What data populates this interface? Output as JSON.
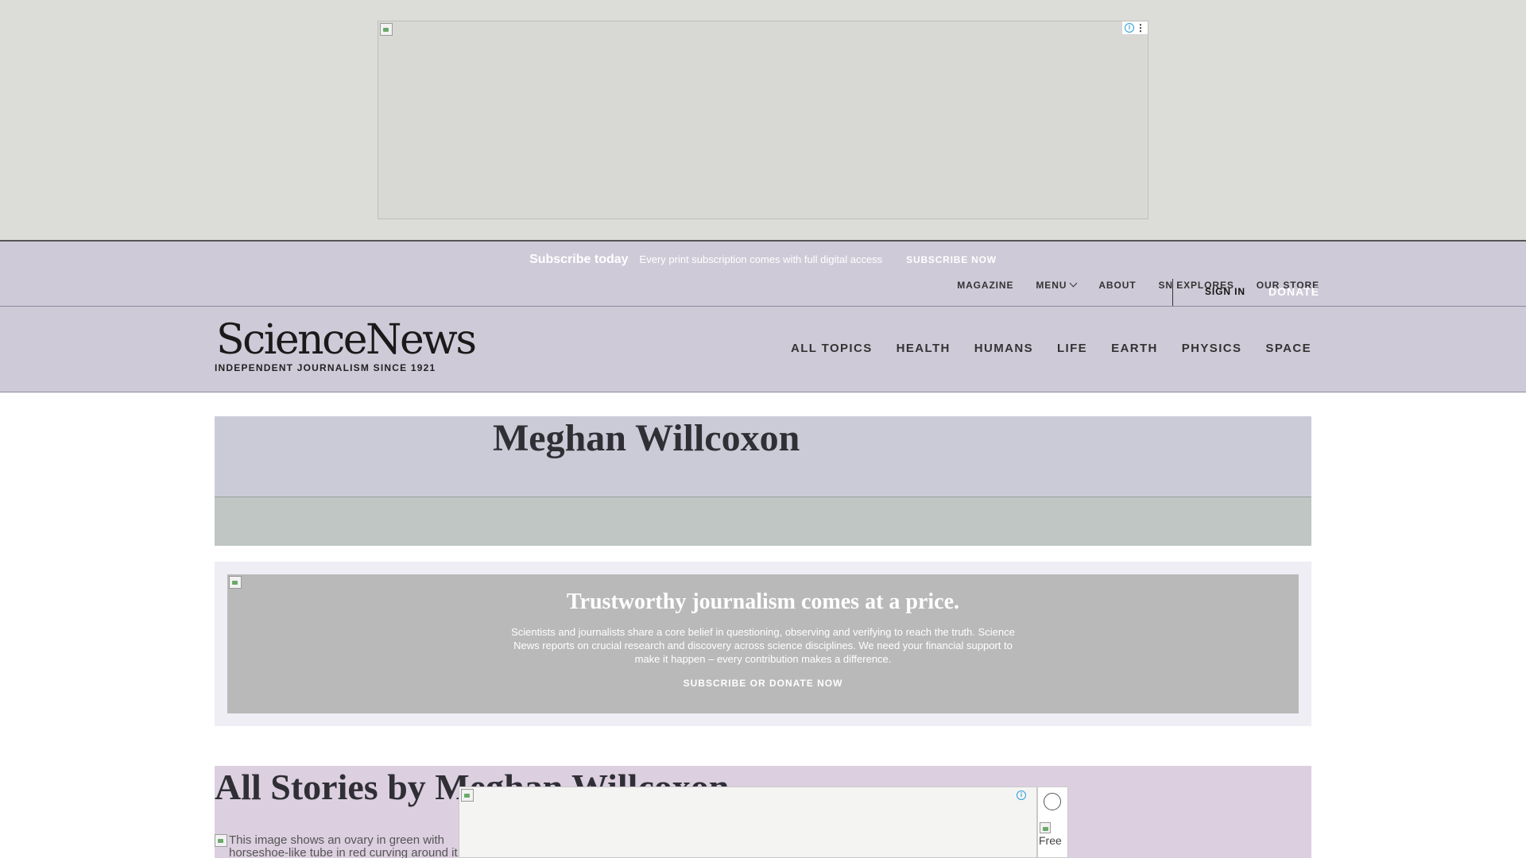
{
  "utility_bar": {
    "promo_title": "Subscribe today",
    "promo_text": "Every print subscription comes with full digital access",
    "promo_cta": "SUBSCRIBE NOW",
    "nav": [
      "MAGAZINE",
      "MENU",
      "ABOUT",
      "SN EXPLORES",
      "OUR STORE"
    ],
    "sign_in": "SIGN IN",
    "donate": "DONATE"
  },
  "header": {
    "logo": "ScienceNews",
    "tagline": "INDEPENDENT JOURNALISM SINCE 1921",
    "topics": [
      "ALL TOPICS",
      "HEALTH",
      "HUMANS",
      "LIFE",
      "EARTH",
      "PHYSICS",
      "SPACE"
    ]
  },
  "author": {
    "name": "Meghan Willcoxon"
  },
  "donation_promo": {
    "title": "Trustworthy journalism comes at a price.",
    "body": "Scientists and journalists share a core belief in questioning, observing and verifying to reach the truth. Science News reports on crucial research and discovery across science disciplines. We need your financial support to make it happen – every contribution makes a difference.",
    "cta": "SUBSCRIBE OR DONATE NOW"
  },
  "stories": {
    "heading": "All Stories by Meghan Willcoxon",
    "first_story_alt": "This image shows an ovary in green with horseshoe-like tube in red curving around it"
  },
  "sticky_ad": {
    "side_thumb_alt": "Free"
  },
  "colors": {
    "utility_bg": "#cfcad8",
    "ad_band_bg": "#dcdcd8",
    "author_bg": "#cbcbd8",
    "stories_bg": "#dcd0e0"
  }
}
